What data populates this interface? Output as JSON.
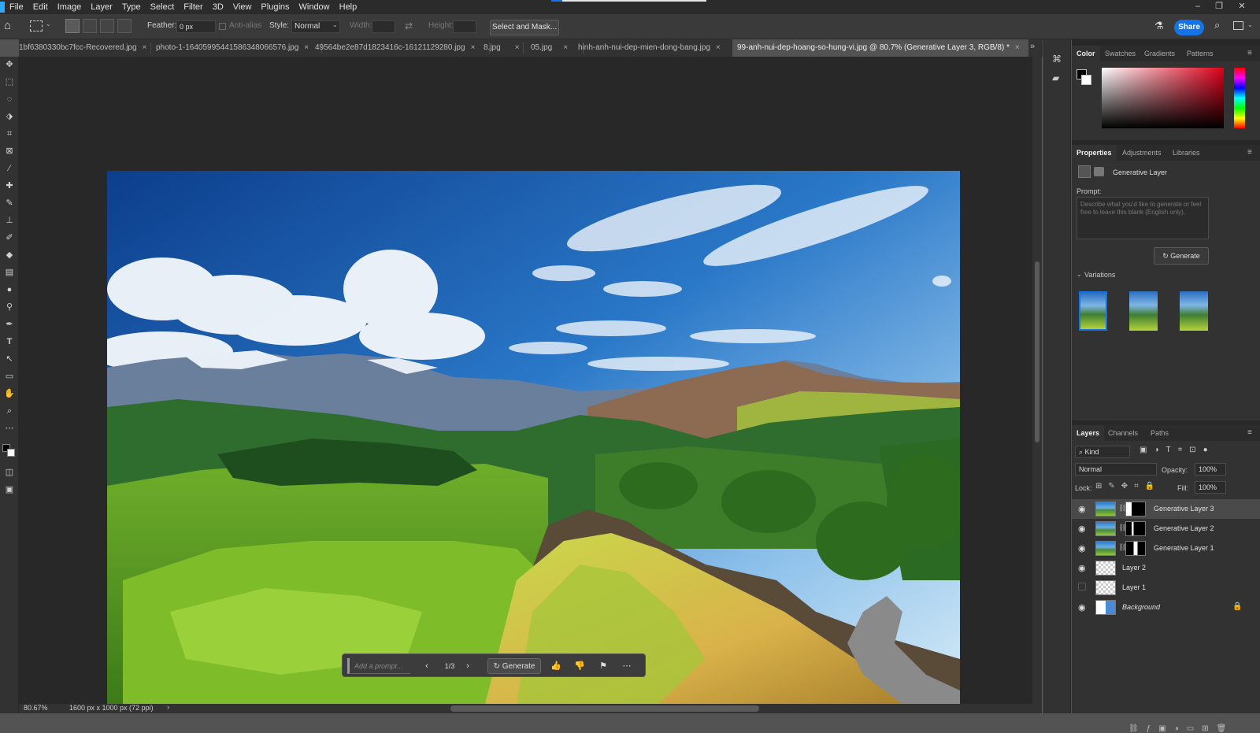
{
  "menubar": {
    "items": [
      "File",
      "Edit",
      "Image",
      "Layer",
      "Type",
      "Select",
      "Filter",
      "3D",
      "View",
      "Plugins",
      "Window",
      "Help"
    ],
    "window_controls": [
      "–",
      "❐",
      "✕"
    ]
  },
  "options": {
    "feather_label": "Feather:",
    "feather_value": "0 px",
    "antialias_label": "Anti-alias",
    "style_label": "Style:",
    "style_value": "Normal",
    "width_label": "Width:",
    "height_label": "Height:",
    "select_mask": "Select and Mask...",
    "share": "Share"
  },
  "tabs": [
    {
      "label": "1bf6380330bc7fcc-Recovered.jpg",
      "x": "×"
    },
    {
      "label": "photo-1-16405995441586348066576.jpg",
      "x": "×"
    },
    {
      "label": "49564be2e87d1823416c-16121129280.jpg",
      "x": "×"
    },
    {
      "label": "8.jpg",
      "x": "×"
    },
    {
      "label": "05.jpg",
      "x": "×"
    },
    {
      "label": "hinh-anh-nui-dep-mien-dong-bang.jpg",
      "x": "×"
    },
    {
      "label": "99-anh-nui-dep-hoang-so-hung-vi.jpg @ 80.7% (Generative Layer 3, RGB/8) *",
      "x": "×"
    }
  ],
  "taskbar": {
    "prompt_placeholder": "Add a prompt...",
    "page": "1/3",
    "generate": "Generate"
  },
  "status": {
    "zoom": "80.67%",
    "doc_info": "1600 px x 1000 px (72 ppi)"
  },
  "color_panel": {
    "tabs": [
      "Color",
      "Swatches",
      "Gradients",
      "Patterns"
    ]
  },
  "properties_panel": {
    "tabs": [
      "Properties",
      "Adjustments",
      "Libraries"
    ],
    "layer_type": "Generative Layer",
    "prompt_label": "Prompt:",
    "prompt_placeholder": "Describe what you'd like to generate or feel free to leave this blank (English only).",
    "generate": "Generate",
    "variations_label": "Variations"
  },
  "layers_panel": {
    "tabs": [
      "Layers",
      "Channels",
      "Paths"
    ],
    "kind": "Kind",
    "blend_mode": "Normal",
    "opacity_label": "Opacity:",
    "opacity_value": "100%",
    "lock_label": "Lock:",
    "fill_label": "Fill:",
    "fill_value": "100%",
    "layers": [
      {
        "name": "Generative Layer 3"
      },
      {
        "name": "Generative Layer 2"
      },
      {
        "name": "Generative Layer 1"
      },
      {
        "name": "Layer 2"
      },
      {
        "name": "Layer 1"
      },
      {
        "name": "Background"
      }
    ]
  },
  "colors": {
    "accent": "#1473e6",
    "chrome_dark": "#2b2b2b",
    "panel": "#323232",
    "canvas_bg": "#282828"
  }
}
